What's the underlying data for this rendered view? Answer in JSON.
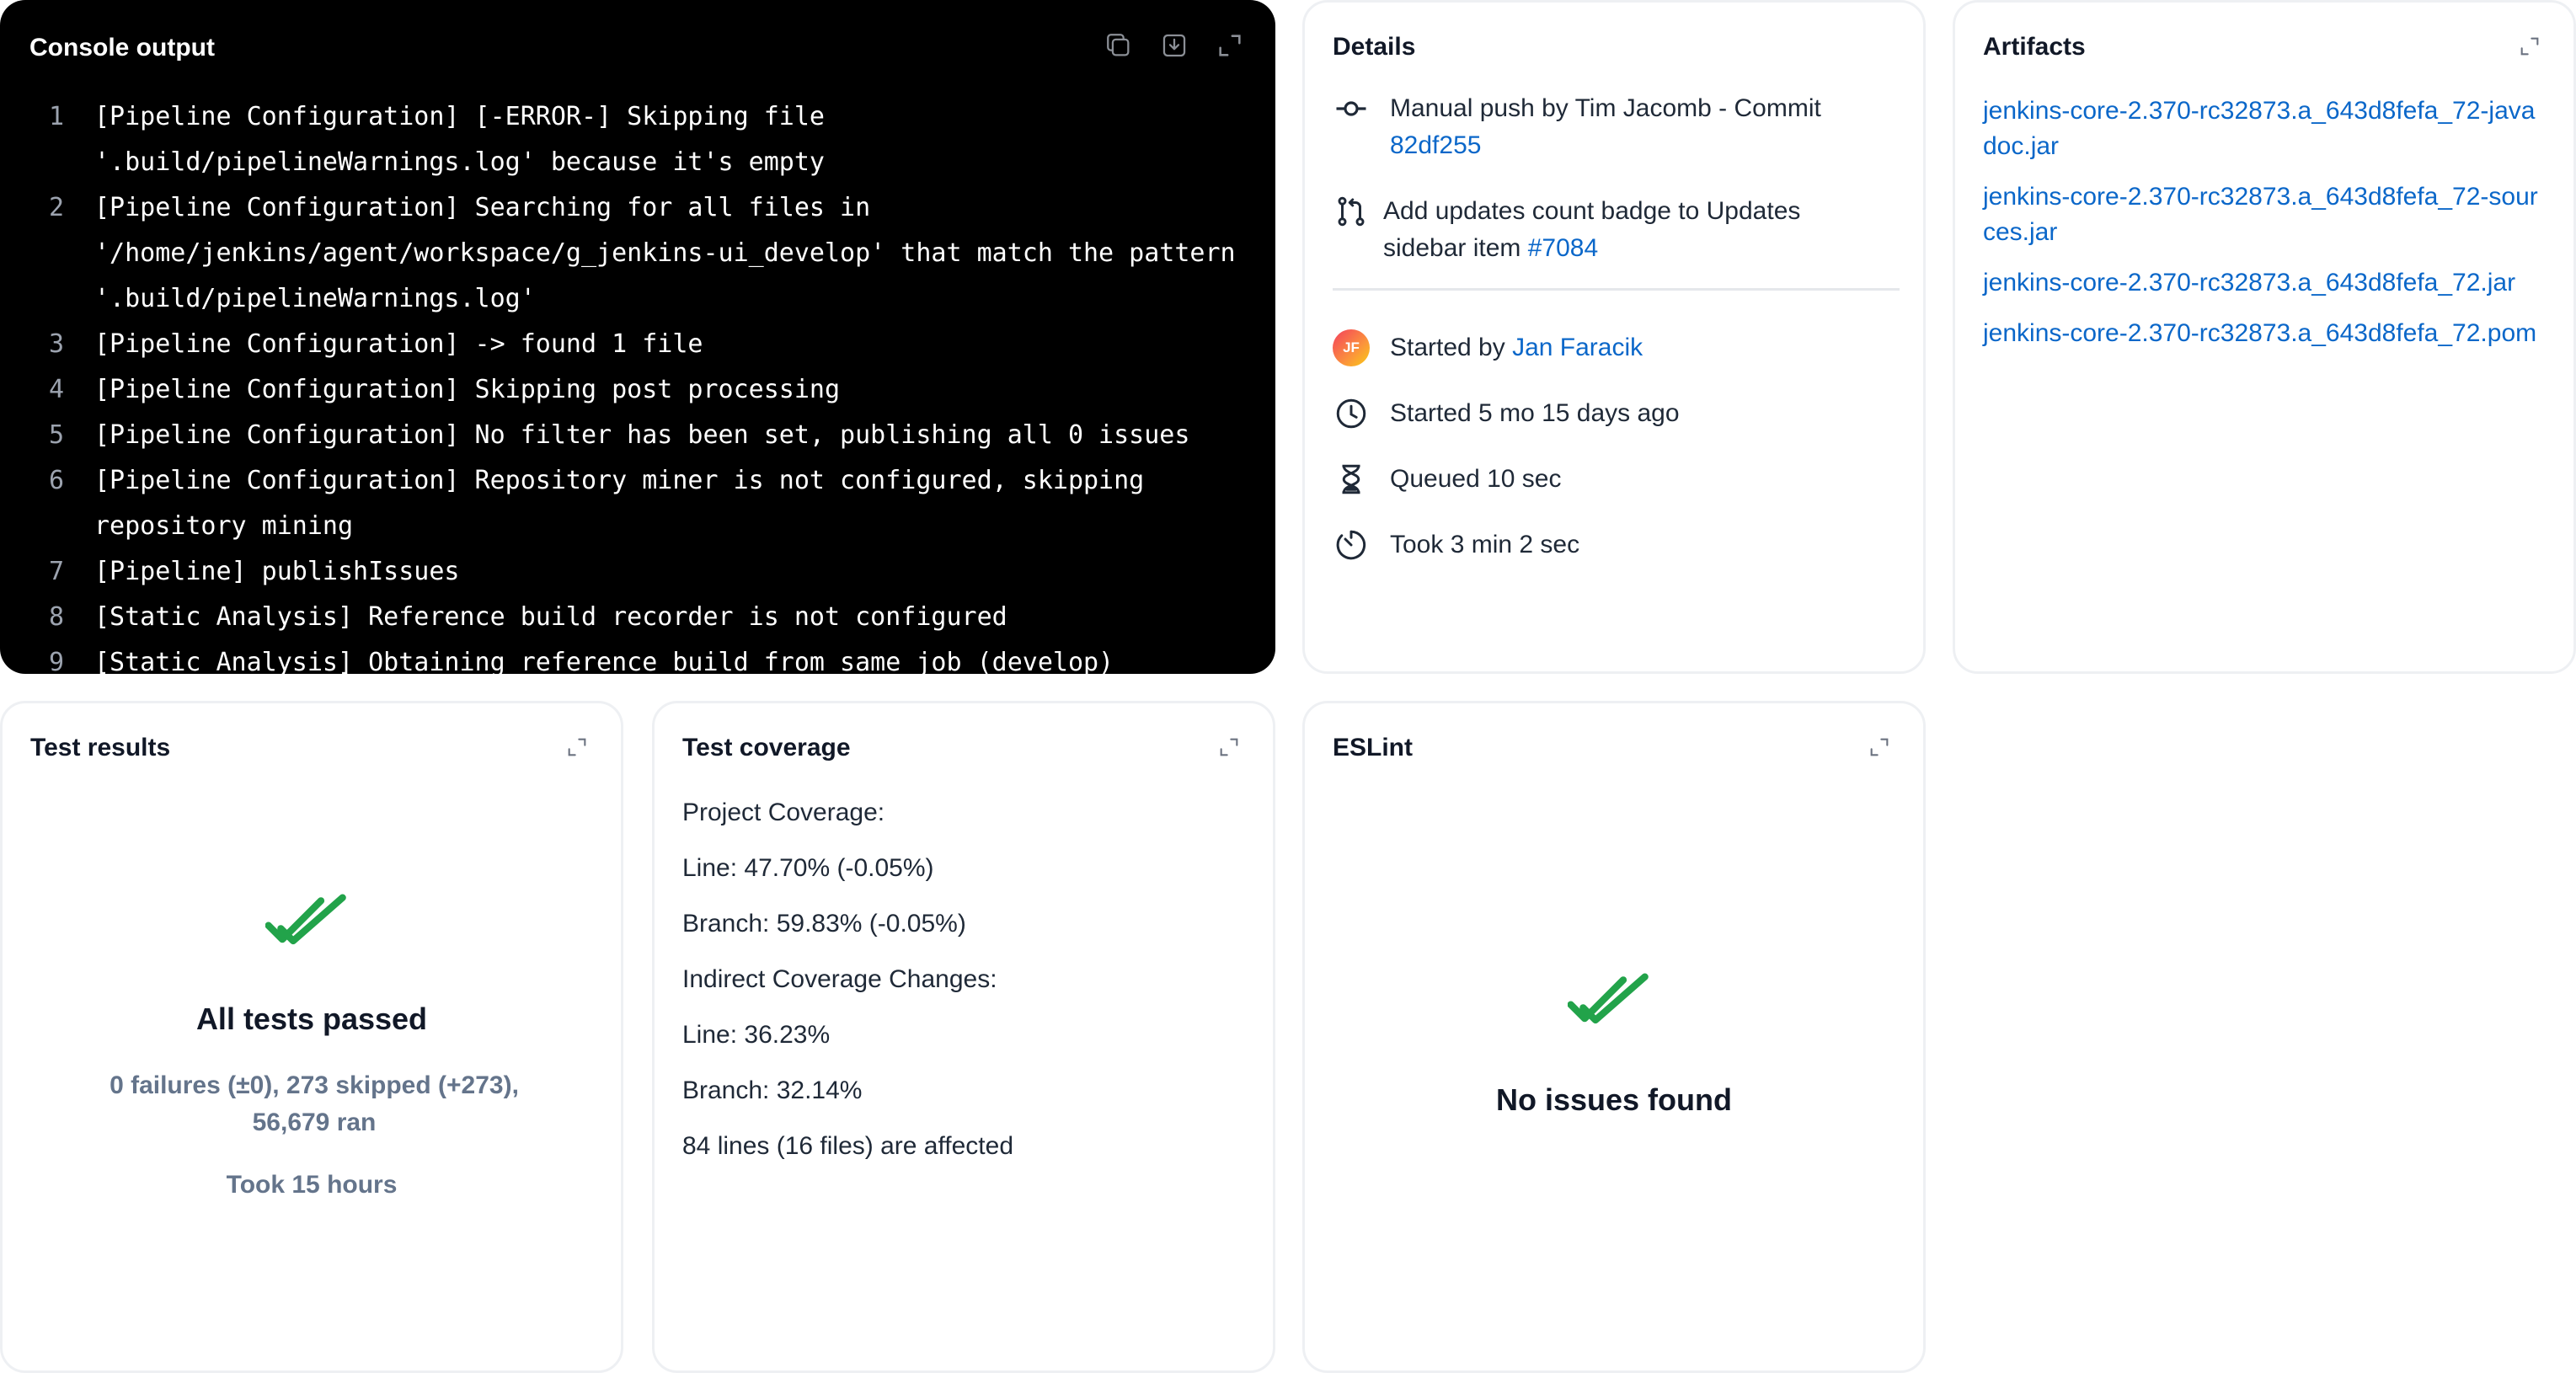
{
  "console": {
    "title": "Console output",
    "lines": [
      {
        "n": "1",
        "text": "[Pipeline Configuration] [-ERROR-] Skipping file '.build/pipelineWarnings.log' because it's empty"
      },
      {
        "n": "2",
        "text": "[Pipeline Configuration] Searching for all files in '/home/jenkins/agent/workspace/g_jenkins-ui_develop' that match the pattern '.build/pipelineWarnings.log'"
      },
      {
        "n": "3",
        "text": "[Pipeline Configuration] -> found 1 file"
      },
      {
        "n": "4",
        "text": "[Pipeline Configuration] Skipping post processing"
      },
      {
        "n": "5",
        "text": "[Pipeline Configuration] No filter has been set, publishing all 0 issues"
      },
      {
        "n": "6",
        "text": "[Pipeline Configuration] Repository miner is not configured, skipping repository mining"
      },
      {
        "n": "7",
        "text": "[Pipeline] publishIssues"
      },
      {
        "n": "8",
        "text": "[Static Analysis] Reference build recorder is not configured"
      },
      {
        "n": "9",
        "text": "[Static Analysis] Obtaining reference build from same job (develop)"
      }
    ]
  },
  "details": {
    "title": "Details",
    "push_text": "Manual push by Tim Jacomb - Commit",
    "commit": "82df255",
    "pr_text": "Add updates count badge to Updates sidebar item",
    "pr_link": "#7084",
    "started_by_label": "Started by",
    "started_by_user": "Jan Faracik",
    "avatar_initials": "JF",
    "started": "Started 5 mo 15 days ago",
    "queued": "Queued 10 sec",
    "took": "Took 3 min 2 sec"
  },
  "artifacts": {
    "title": "Artifacts",
    "items": [
      "jenkins-core-2.370-rc32873.a_643d8fefa_72-javadoc.jar",
      "jenkins-core-2.370-rc32873.a_643d8fefa_72-sources.jar",
      "jenkins-core-2.370-rc32873.a_643d8fefa_72.jar",
      "jenkins-core-2.370-rc32873.a_643d8fefa_72.pom"
    ]
  },
  "tests": {
    "title": "Test results",
    "status": "All tests passed",
    "summary": "0 failures (±0), 273 skipped (+273), 56,679 ran",
    "duration": "Took 15 hours"
  },
  "coverage": {
    "title": "Test coverage",
    "lines": [
      "Project Coverage:",
      "Line: 47.70% (-0.05%)",
      "Branch: 59.83% (-0.05%)",
      "Indirect Coverage Changes:",
      "Line: 36.23%",
      "Branch: 32.14%",
      "84 lines (16 files) are affected"
    ]
  },
  "eslint": {
    "title": "ESLint",
    "status": "No issues found"
  },
  "colors": {
    "link": "#0b67c9",
    "success": "#22a34a",
    "console_bg": "#000000"
  }
}
